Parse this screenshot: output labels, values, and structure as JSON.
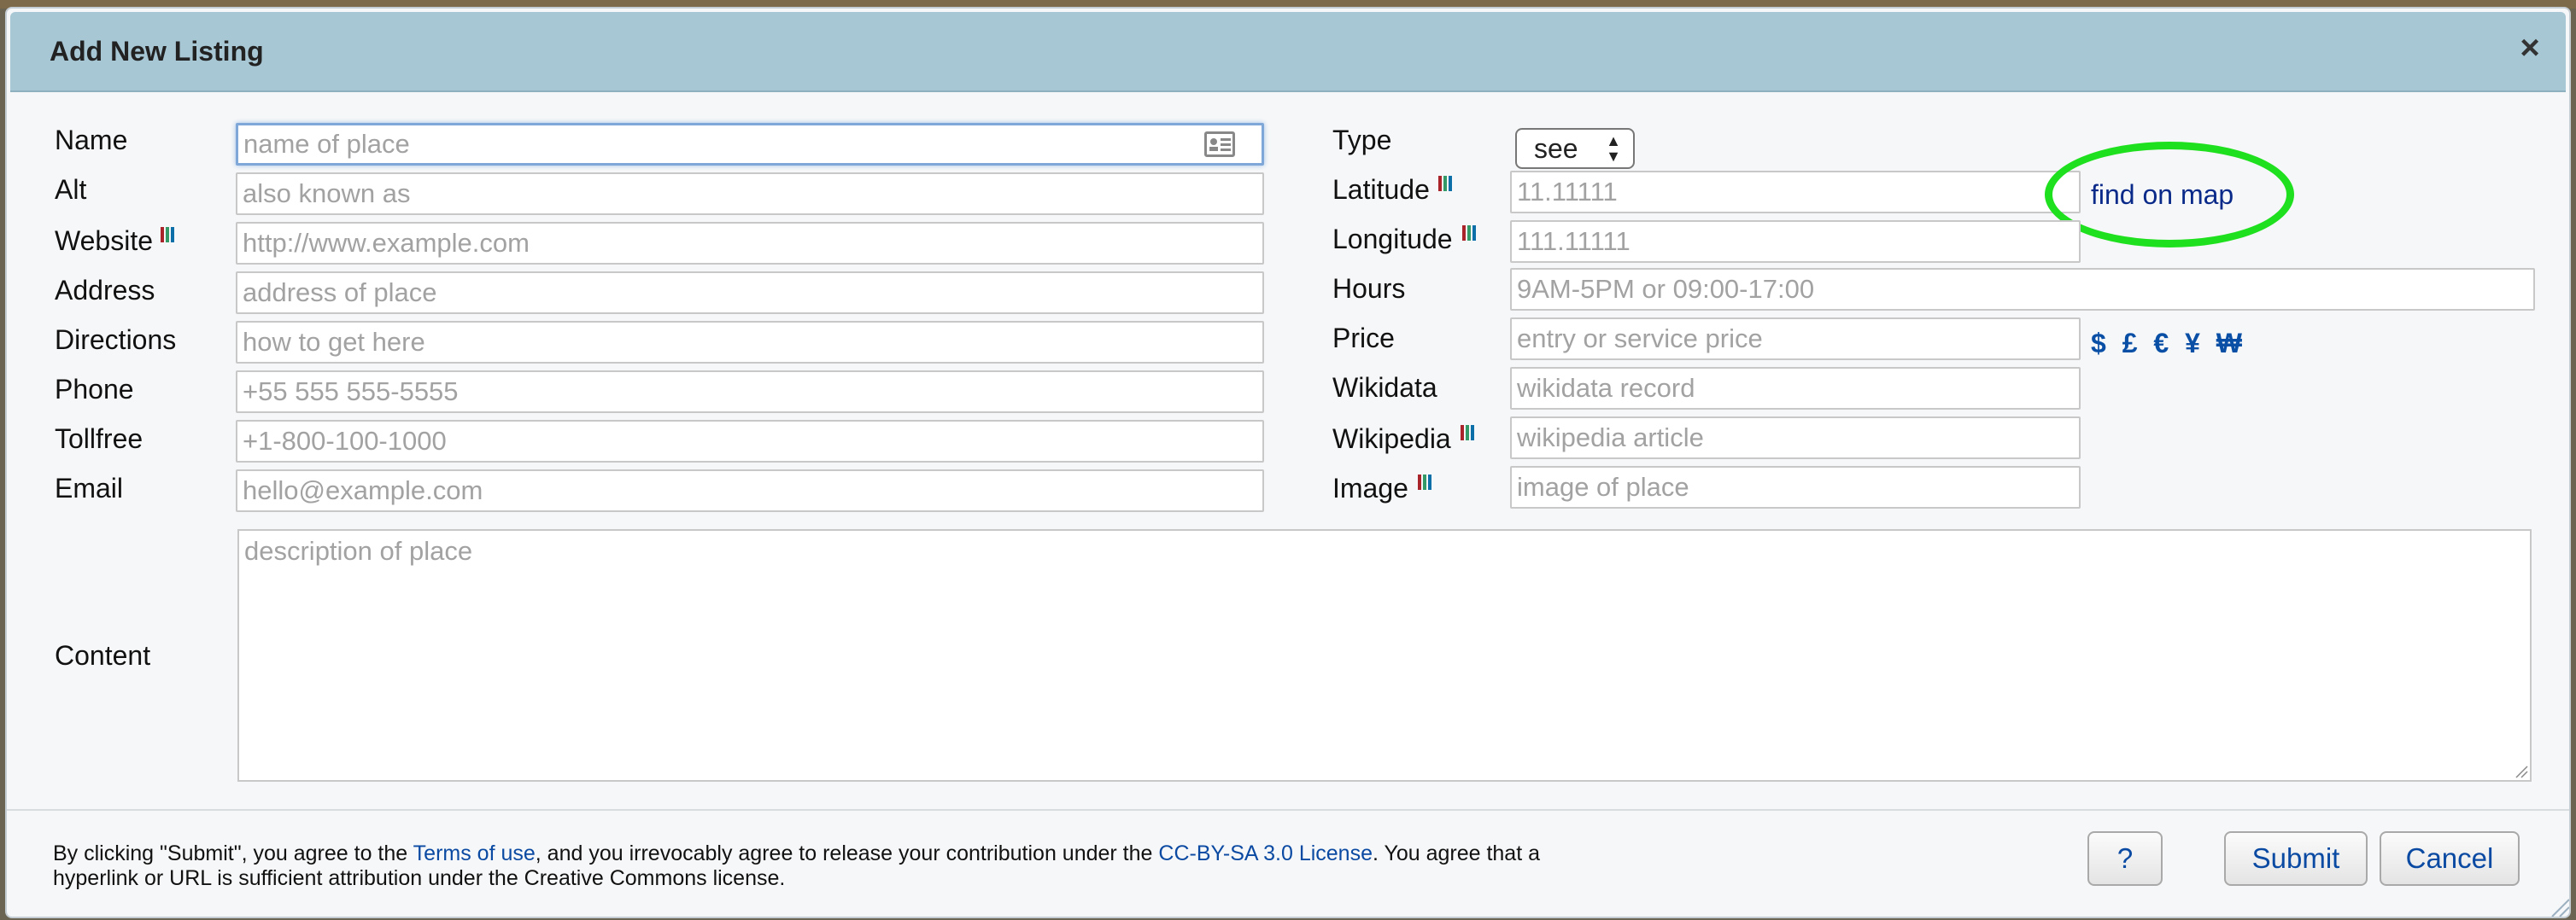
{
  "dialog": {
    "title": "Add New Listing",
    "close_label": "×"
  },
  "form": {
    "name": {
      "label": "Name",
      "placeholder": "name of place"
    },
    "alt": {
      "label": "Alt",
      "placeholder": "also known as"
    },
    "website": {
      "label": "Website",
      "placeholder": "http://www.example.com"
    },
    "address": {
      "label": "Address",
      "placeholder": "address of place"
    },
    "directions": {
      "label": "Directions",
      "placeholder": "how to get here"
    },
    "phone": {
      "label": "Phone",
      "placeholder": "+55 555 555-5555"
    },
    "tollfree": {
      "label": "Tollfree",
      "placeholder": "+1-800-100-1000"
    },
    "email": {
      "label": "Email",
      "placeholder": "hello@example.com"
    },
    "type": {
      "label": "Type",
      "value": "see"
    },
    "latitude": {
      "label": "Latitude",
      "placeholder": "11.11111"
    },
    "longitude": {
      "label": "Longitude",
      "placeholder": "111.11111"
    },
    "hours": {
      "label": "Hours",
      "placeholder": "9AM-5PM or 09:00-17:00"
    },
    "price": {
      "label": "Price",
      "placeholder": "entry or service price"
    },
    "wikidata": {
      "label": "Wikidata",
      "placeholder": "wikidata record"
    },
    "wikipedia": {
      "label": "Wikipedia",
      "placeholder": "wikipedia article"
    },
    "image": {
      "label": "Image",
      "placeholder": "image of place"
    },
    "content": {
      "label": "Content",
      "placeholder": "description of place"
    },
    "find_on_map": "find on map",
    "currency_symbols": [
      "$",
      "£",
      "€",
      "¥",
      "₩"
    ]
  },
  "footer": {
    "text_1": "By clicking \"Submit\", you agree to the ",
    "terms_link": "Terms of use",
    "text_2": ", and you irrevocably agree to release your contribution under the ",
    "license_link": "CC-BY-SA 3.0 License",
    "text_3": ". You agree that a hyperlink or URL is sufficient attribution under the Creative Commons license."
  },
  "buttons": {
    "help": "?",
    "submit": "Submit",
    "cancel": "Cancel"
  },
  "colors": {
    "titlebar": "#a7c7d5",
    "link": "#0b4aa2",
    "highlight_ellipse": "#1ee01e"
  },
  "icons": [
    "wikidata-icon",
    "contact-card-icon",
    "close-icon",
    "resize-grip-icon"
  ]
}
